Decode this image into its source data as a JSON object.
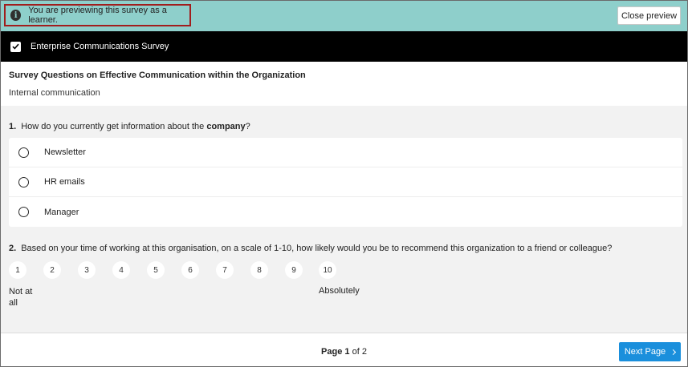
{
  "banner": {
    "notice": "You are previewing this survey as a learner.",
    "close_label": "Close preview",
    "icon": "info-icon",
    "color": "#8ecfcb"
  },
  "survey": {
    "title": "Enterprise Communications Survey",
    "icon": "checkbox-icon"
  },
  "section": {
    "title": "Survey Questions on Effective Communication within the Organization",
    "subtitle": "Internal communication"
  },
  "questions": [
    {
      "number": "1.",
      "text_before": "How do you currently get information about the ",
      "text_strong": "company",
      "text_after": "?",
      "options": [
        "Newsletter",
        "HR emails",
        "Manager"
      ]
    },
    {
      "number": "2.",
      "text": "Based on your time of working at this organisation, on a scale of 1-10, how likely would you be to recommend this organization to a friend or colleague?",
      "scale": [
        "1",
        "2",
        "3",
        "4",
        "5",
        "6",
        "7",
        "8",
        "9",
        "10"
      ],
      "low_label": "Not at all",
      "high_label": "Absolutely"
    }
  ],
  "footer": {
    "page_word": "Page",
    "current_page": "1",
    "of_word": "of",
    "total_pages": "2",
    "next_label": "Next Page",
    "accent": "#1a8fdc"
  }
}
